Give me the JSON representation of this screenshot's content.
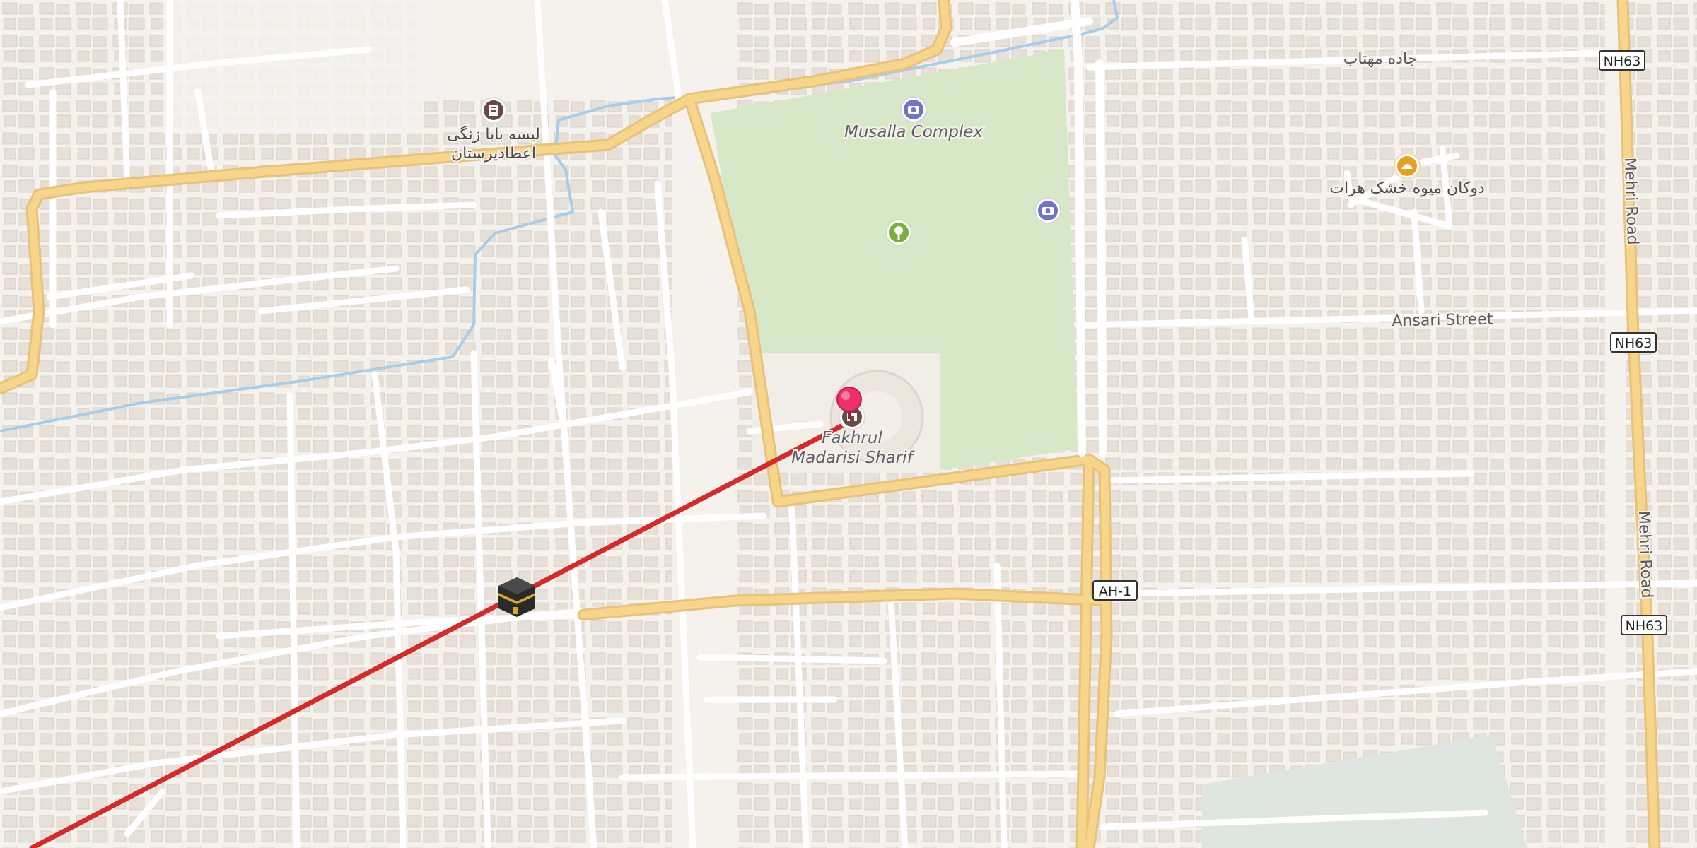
{
  "map": {
    "colors": {
      "background": "#f5f2ee",
      "building": "#e6e0d9",
      "park": "#d6e8c8",
      "major_road": "#f7d58a",
      "water": "#a8cdea",
      "route": "#d42a2a",
      "pin": "#ef2f6b",
      "camera_icon": "#6f74c4",
      "tree_icon": "#7cae3c",
      "food_icon": "#e8a020"
    },
    "pois": {
      "musalla_complex": "Musalla Complex",
      "fakhrul_line1": "Fakhrul",
      "fakhrul_line2": "Madarisi Sharif",
      "school_line1": "لیسه بابا زنگی",
      "school_line2": "اعطادیرستان",
      "dried_fruit_shop": "دوکان میوه خشک هرات"
    },
    "streets": {
      "jada_mahtab": "جاده مهتاب",
      "ansari_street": "Ansari Street",
      "mehri_road_north": "Mehri Road",
      "mehri_road_south": "Mehri Road"
    },
    "shields": {
      "nh63_top": "NH63",
      "nh63_mid": "NH63",
      "nh63_bottom": "NH63",
      "ah1": "AH-1"
    },
    "icons": {
      "destination_pin": "map-pin-icon",
      "origin_marker": "kaaba-icon",
      "camera_1": "camera-icon",
      "camera_2": "camera-icon",
      "park": "tree-icon",
      "school": "school-icon",
      "landmark": "monument-icon",
      "food": "bakery-icon"
    }
  }
}
